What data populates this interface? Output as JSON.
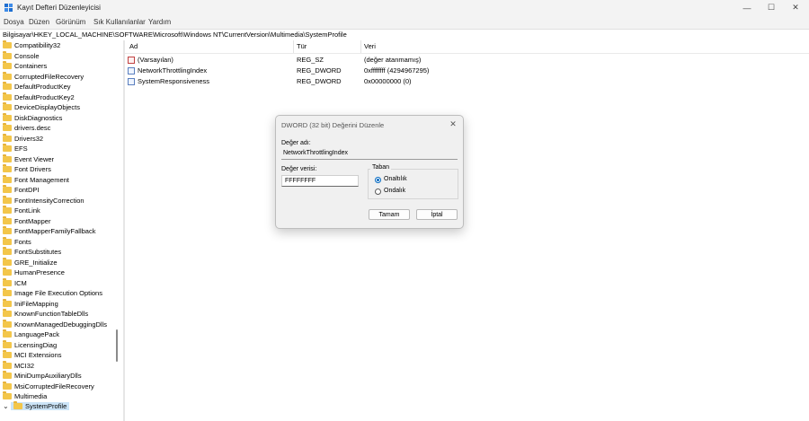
{
  "window": {
    "title": "Kayıt Defteri Düzenleyicisi",
    "minimize": "—",
    "maximize": "☐",
    "close": "✕"
  },
  "menu": [
    "Dosya",
    "Düzen",
    "Görünüm",
    "Sık Kullanılanlar",
    "Yardım"
  ],
  "address": "Bilgisayar\\HKEY_LOCAL_MACHINE\\SOFTWARE\\Microsoft\\Windows NT\\CurrentVersion\\Multimedia\\SystemProfile",
  "tree": {
    "items": [
      "Compatibility32",
      "Console",
      "Containers",
      "CorruptedFileRecovery",
      "DefaultProductKey",
      "DefaultProductKey2",
      "DeviceDisplayObjects",
      "DiskDiagnostics",
      "drivers.desc",
      "Drivers32",
      "EFS",
      "Event Viewer",
      "Font Drivers",
      "Font Management",
      "FontDPI",
      "FontIntensityCorrection",
      "FontLink",
      "FontMapper",
      "FontMapperFamilyFallback",
      "Fonts",
      "FontSubstitutes",
      "GRE_Initialize",
      "HumanPresence",
      "ICM",
      "Image File Execution Options",
      "IniFileMapping",
      "KnownFunctionTableDlls",
      "KnownManagedDebuggingDlls",
      "LanguagePack",
      "LicensingDiag",
      "MCI Extensions",
      "MCI32",
      "MiniDumpAuxiliaryDlls",
      "MsiCorruptedFileRecovery",
      "Multimedia"
    ],
    "selected": "SystemProfile",
    "expand_glyph": "⌄"
  },
  "list": {
    "headers": [
      "Ad",
      "Tür",
      "Veri"
    ],
    "rows": [
      {
        "name": "(Varsayılan)",
        "type": "REG_SZ",
        "data": "(değer atanmamış)",
        "icon": "string-value-icon"
      },
      {
        "name": "NetworkThrottlingIndex",
        "type": "REG_DWORD",
        "data": "0xffffffff (4294967295)",
        "icon": "dword-value-icon"
      },
      {
        "name": "SystemResponsiveness",
        "type": "REG_DWORD",
        "data": "0x00000000 (0)",
        "icon": "dword-value-icon"
      }
    ]
  },
  "dialog": {
    "title": "DWORD (32 bit) Değerini Düzenle",
    "close": "✕",
    "name_label": "Değer adı:",
    "name_value": "NetworkThrottlingIndex",
    "data_label": "Değer verisi:",
    "data_value": "FFFFFFFF",
    "base_label": "Taban",
    "radio_hex": "Onaltılık",
    "radio_dec": "Ondalık",
    "selected_base": "Onaltılık",
    "ok": "Tamam",
    "cancel": "İptal"
  },
  "colors": {
    "accent": "#0067c0",
    "folder": "#f3c64a",
    "selection": "#cce4f7"
  }
}
